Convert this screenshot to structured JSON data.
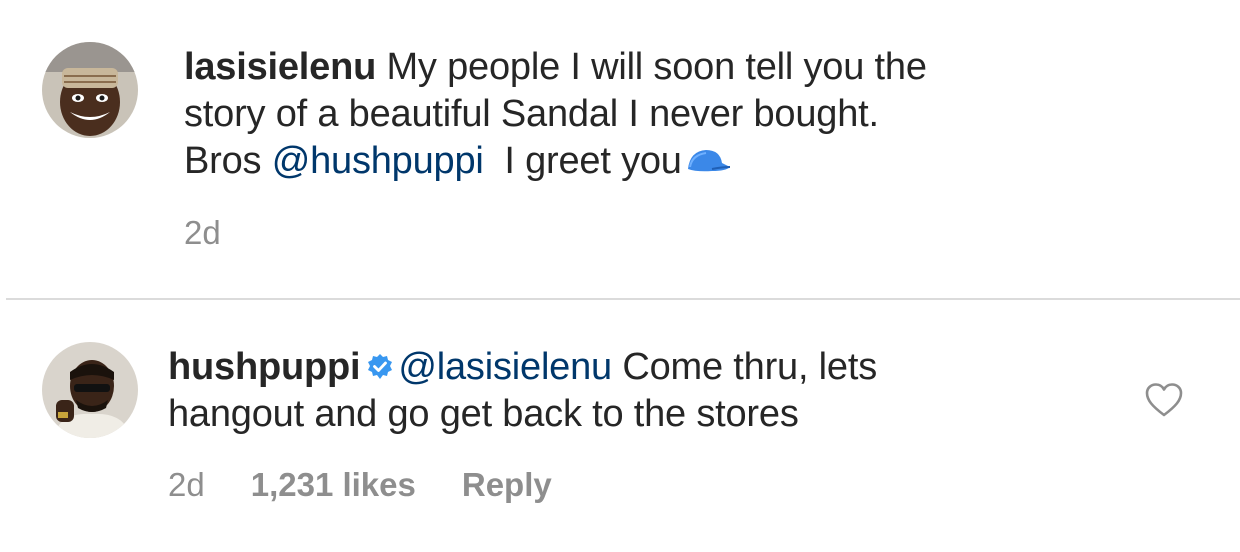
{
  "comments": [
    {
      "username": "lasisielenu",
      "line1": " My people I will soon tell you the",
      "line2": "story of a beautiful Sandal I never bought.",
      "line3_prefix": "Bros ",
      "mention": "@hushpuppi",
      "line3_suffix": "  I greet you",
      "emoji": "blue-cap-icon",
      "time": "2d"
    },
    {
      "username": "hushpuppi",
      "verified": true,
      "mention": "@lasisielenu",
      "line1_suffix": " Come thru, lets",
      "line2": "hangout and go get back to the stores",
      "time": "2d",
      "likes": "1,231 likes",
      "reply_label": "Reply"
    }
  ],
  "colors": {
    "text": "#262626",
    "mention": "#00376b",
    "meta": "#8e8e8e",
    "divider": "#dbdbdb",
    "verified": "#3897f0",
    "cap": "#3b88e8"
  }
}
